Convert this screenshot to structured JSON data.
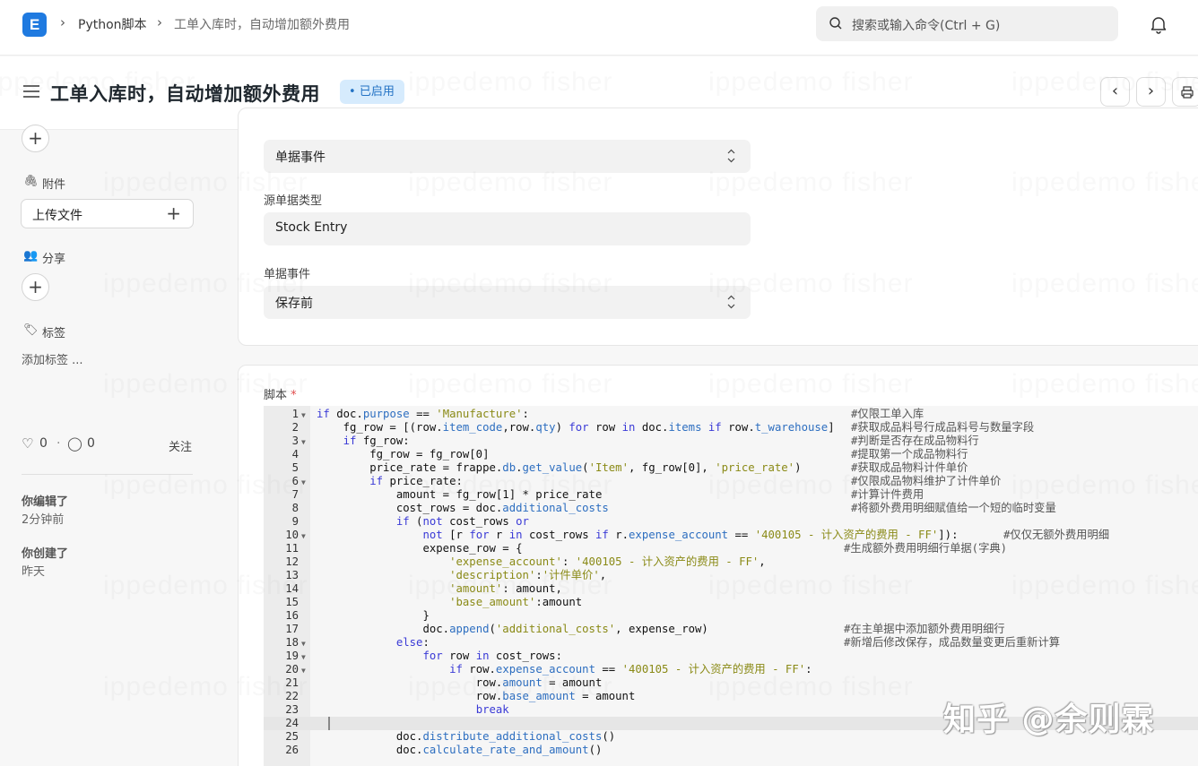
{
  "topnav": {
    "logo": "E",
    "breadcrumbs": [
      "Python脚本",
      "工单入库时，自动增加额外费用"
    ],
    "search_placeholder": "搜索或输入命令(Ctrl + G)"
  },
  "header": {
    "title": "工单入库时，自动增加额外费用",
    "status": "已启用"
  },
  "watermark": "ippedemo fisher",
  "sidebar": {
    "attachments_label": "附件",
    "upload_label": "上传文件",
    "share_label": "分享",
    "tags_label": "标签",
    "add_tag": "添加标签 ...",
    "likes": "0",
    "comments": "0",
    "follow": "关注",
    "edited_label": "你编辑了",
    "edited_time": "2分钟前",
    "created_label": "你创建了",
    "created_time": "昨天"
  },
  "form": {
    "script_type_value": "单据事件",
    "reference_doctype_label": "源单据类型",
    "reference_doctype_value": "Stock Entry",
    "doc_event_label": "单据事件",
    "doc_event_value": "保存前",
    "script_label": "脚本",
    "required_mark": "*"
  },
  "code_lines": [
    {
      "n": "1",
      "fold": true,
      "code": "if doc.purpose == 'Manufacture':",
      "comment": "#仅限工单入库"
    },
    {
      "n": "2",
      "fold": false,
      "code": "    fg_row = [(row.item_code,row.qty) for row in doc.items if row.t_warehouse]",
      "comment": "#获取成品料号行成品料号与数量字段"
    },
    {
      "n": "3",
      "fold": true,
      "code": "    if fg_row:",
      "comment": "#判断是否存在成品物料行"
    },
    {
      "n": "4",
      "fold": false,
      "code": "        fg_row = fg_row[0]",
      "comment": "#提取第一个成品物料行"
    },
    {
      "n": "5",
      "fold": false,
      "code": "        price_rate = frappe.db.get_value('Item', fg_row[0], 'price_rate')",
      "comment": "#获取成品物料计件单价"
    },
    {
      "n": "6",
      "fold": true,
      "code": "        if price_rate:",
      "comment": "#仅限成品物料维护了计件单价"
    },
    {
      "n": "7",
      "fold": false,
      "code": "            amount = fg_row[1] * price_rate",
      "comment": "#计算计件费用"
    },
    {
      "n": "8",
      "fold": false,
      "code": "            cost_rows = doc.additional_costs",
      "comment": "#将额外费用明细赋值给一个短的临时变量"
    },
    {
      "n": "9",
      "fold": false,
      "code": "            if (not cost_rows or",
      "comment": ""
    },
    {
      "n": "10",
      "fold": true,
      "code": "                not [r for r in cost_rows if r.expense_account == '400105 - 计入资产的费用 - FF']):",
      "comment": "#仅仅无额外费用明细"
    },
    {
      "n": "11",
      "fold": false,
      "code": "                expense_row = {",
      "comment": "#生成额外费用明细行单据(字典)"
    },
    {
      "n": "12",
      "fold": false,
      "code": "                    'expense_account': '400105 - 计入资产的费用 - FF',",
      "comment": ""
    },
    {
      "n": "13",
      "fold": false,
      "code": "                    'description':'计件单价',",
      "comment": ""
    },
    {
      "n": "14",
      "fold": false,
      "code": "                    'amount': amount,",
      "comment": ""
    },
    {
      "n": "15",
      "fold": false,
      "code": "                    'base_amount':amount",
      "comment": ""
    },
    {
      "n": "16",
      "fold": false,
      "code": "                }",
      "comment": ""
    },
    {
      "n": "17",
      "fold": false,
      "code": "                doc.append('additional_costs', expense_row)",
      "comment": "#在主单据中添加额外费用明细行"
    },
    {
      "n": "18",
      "fold": true,
      "code": "            else:",
      "comment": "#新增后修改保存，成品数量变更后重新计算"
    },
    {
      "n": "19",
      "fold": true,
      "code": "                for row in cost_rows:",
      "comment": ""
    },
    {
      "n": "20",
      "fold": true,
      "code": "                    if row.expense_account == '400105 - 计入资产的费用 - FF':",
      "comment": ""
    },
    {
      "n": "21",
      "fold": false,
      "code": "                        row.amount = amount",
      "comment": ""
    },
    {
      "n": "22",
      "fold": false,
      "code": "                        row.base_amount = amount",
      "comment": ""
    },
    {
      "n": "23",
      "fold": false,
      "code": "                        break",
      "comment": ""
    },
    {
      "n": "24",
      "fold": false,
      "code": "",
      "comment": ""
    },
    {
      "n": "25",
      "fold": false,
      "code": "            doc.distribute_additional_costs()",
      "comment": ""
    },
    {
      "n": "26",
      "fold": false,
      "code": "            doc.calculate_rate_and_amount()",
      "comment": ""
    }
  ],
  "overlay_watermark": "知乎 @余则霖"
}
